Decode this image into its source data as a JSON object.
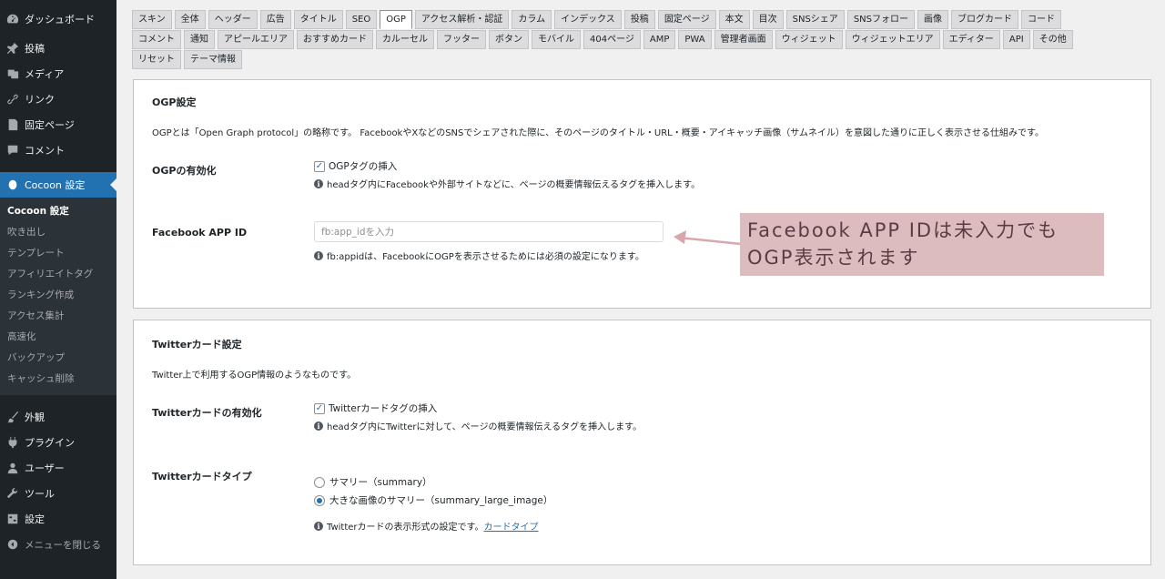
{
  "sidebar": {
    "top_items": [
      {
        "label": "ダッシュボード",
        "icon": "dashboard-icon"
      },
      {
        "label": "投稿",
        "icon": "pin-icon"
      },
      {
        "label": "メディア",
        "icon": "media-icon"
      },
      {
        "label": "リンク",
        "icon": "link-icon"
      },
      {
        "label": "固定ページ",
        "icon": "page-icon"
      },
      {
        "label": "コメント",
        "icon": "comment-icon"
      }
    ],
    "current_item": {
      "label": "Cocoon 設定",
      "icon": "cocoon-icon"
    },
    "submenu": [
      {
        "label": "Cocoon 設定",
        "current": true
      },
      {
        "label": "吹き出し"
      },
      {
        "label": "テンプレート"
      },
      {
        "label": "アフィリエイトタグ"
      },
      {
        "label": "ランキング作成"
      },
      {
        "label": "アクセス集計"
      },
      {
        "label": "高速化"
      },
      {
        "label": "バックアップ"
      },
      {
        "label": "キャッシュ削除"
      }
    ],
    "bottom_items": [
      {
        "label": "外観",
        "icon": "brush-icon"
      },
      {
        "label": "プラグイン",
        "icon": "plugin-icon"
      },
      {
        "label": "ユーザー",
        "icon": "user-icon"
      },
      {
        "label": "ツール",
        "icon": "wrench-icon"
      },
      {
        "label": "設定",
        "icon": "settings-icon"
      }
    ],
    "collapse_label": "メニューを閉じる"
  },
  "tabs": {
    "rows": [
      [
        "スキン",
        "全体",
        "ヘッダー",
        "広告",
        "タイトル",
        "SEO",
        "OGP",
        "アクセス解析・認証",
        "カラム",
        "インデックス",
        "投稿",
        "固定ページ",
        "本文",
        "目次",
        "SNSシェア",
        "SNSフォロー",
        "画像",
        "ブログカード",
        "コード"
      ],
      [
        "コメント",
        "通知",
        "アピールエリア",
        "おすすめカード",
        "カルーセル",
        "フッター",
        "ボタン",
        "モバイル",
        "404ページ",
        "AMP",
        "PWA",
        "管理者画面",
        "ウィジェット",
        "ウィジェットエリア",
        "エディター",
        "API",
        "その他"
      ],
      [
        "リセット",
        "テーマ情報"
      ]
    ],
    "active": "OGP"
  },
  "ogp": {
    "title": "OGP設定",
    "description": "OGPとは「Open Graph protocol」の略称です。 FacebookやXなどのSNSでシェアされた際に、そのページのタイトル・URL・概要・アイキャッチ画像（サムネイル）を意図した通りに正しく表示させる仕組みです。",
    "enable_label": "OGPの有効化",
    "enable_checkbox_label": "OGPタグの挿入",
    "enable_checked": true,
    "enable_help": "headタグ内にFacebookや外部サイトなどに、ページの概要情報伝えるタグを挿入します。",
    "fb_label": "Facebook APP ID",
    "fb_placeholder": "fb:app_idを入力",
    "fb_value": "",
    "fb_help": "fb:appidは、FacebookにOGPを表示させるためには必須の設定になります。"
  },
  "twitter": {
    "title": "Twitterカード設定",
    "description": "Twitter上で利用するOGP情報のようなものです。",
    "enable_label": "Twitterカードの有効化",
    "enable_checkbox_label": "Twitterカードタグの挿入",
    "enable_checked": true,
    "enable_help": "headタグ内にTwitterに対して、ページの概要情報伝えるタグを挿入します。",
    "type_label": "Twitterカードタイプ",
    "type_options": [
      {
        "label": "サマリー（summary）",
        "checked": false
      },
      {
        "label": "大きな画像のサマリー（summary_large_image）",
        "checked": true
      }
    ],
    "type_help_prefix": "Twitterカードの表示形式の設定です。",
    "type_help_link": "カードタイプ"
  },
  "annotation": {
    "line1": "Facebook APP IDは未入力でも",
    "line2": "OGP表示されます",
    "color": "#ddbcc0",
    "arrow_color": "#d8a7ae"
  },
  "colors": {
    "sidebar_bg": "#1d2327",
    "accent": "#2271b1",
    "page_bg": "#f0f0f1"
  }
}
